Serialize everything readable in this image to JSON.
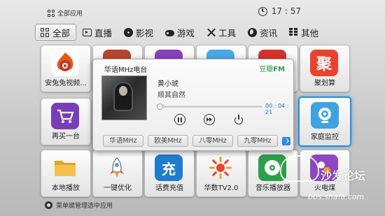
{
  "header": {
    "app_title": "全部应用",
    "clock": "17 : 57"
  },
  "tabs": [
    {
      "label": "全部",
      "icon": "grid-icon"
    },
    {
      "label": "直播",
      "icon": "tv-icon"
    },
    {
      "label": "影视",
      "icon": "film-reel-icon"
    },
    {
      "label": "游戏",
      "icon": "gamepad-icon"
    },
    {
      "label": "工具",
      "icon": "tools-icon"
    },
    {
      "label": "资讯",
      "icon": "globe-icon"
    },
    {
      "label": "其他",
      "icon": "list-icon"
    }
  ],
  "tiles": {
    "r1": [
      "安兔兔视频...",
      "",
      "",
      "",
      "",
      "聚划算"
    ],
    "r2": [
      "再买一台",
      "",
      "",
      "",
      "",
      "家庭监控"
    ],
    "r3": [
      "本地播放",
      "一键优化",
      "话费充值",
      "华数TV2.0",
      "音乐播放器",
      "火电煤"
    ]
  },
  "tile_icons": {
    "r3_2_glyph": "充",
    "r1_5_glyph": "聚"
  },
  "popup": {
    "title": "华语MHz电台",
    "brand_prefix": "豆瓣",
    "brand_suffix": "FM",
    "song": "黄小琥",
    "artist": "顺其自然",
    "time": "00 : 04 : 21",
    "progress_fraction": 0.02,
    "channels": [
      "华语MHz",
      "欧美MHz",
      "八零MHz",
      "九零MHz"
    ]
  },
  "footer": {
    "hint": "菜单键管理选中应用"
  },
  "watermark": {
    "big": "沙发论坛",
    "url": "bbs.shafa.com"
  },
  "colors": {
    "accent": "#2a8be0",
    "douban_green": "#2d9c55",
    "time_blue": "#1a6fc2"
  }
}
